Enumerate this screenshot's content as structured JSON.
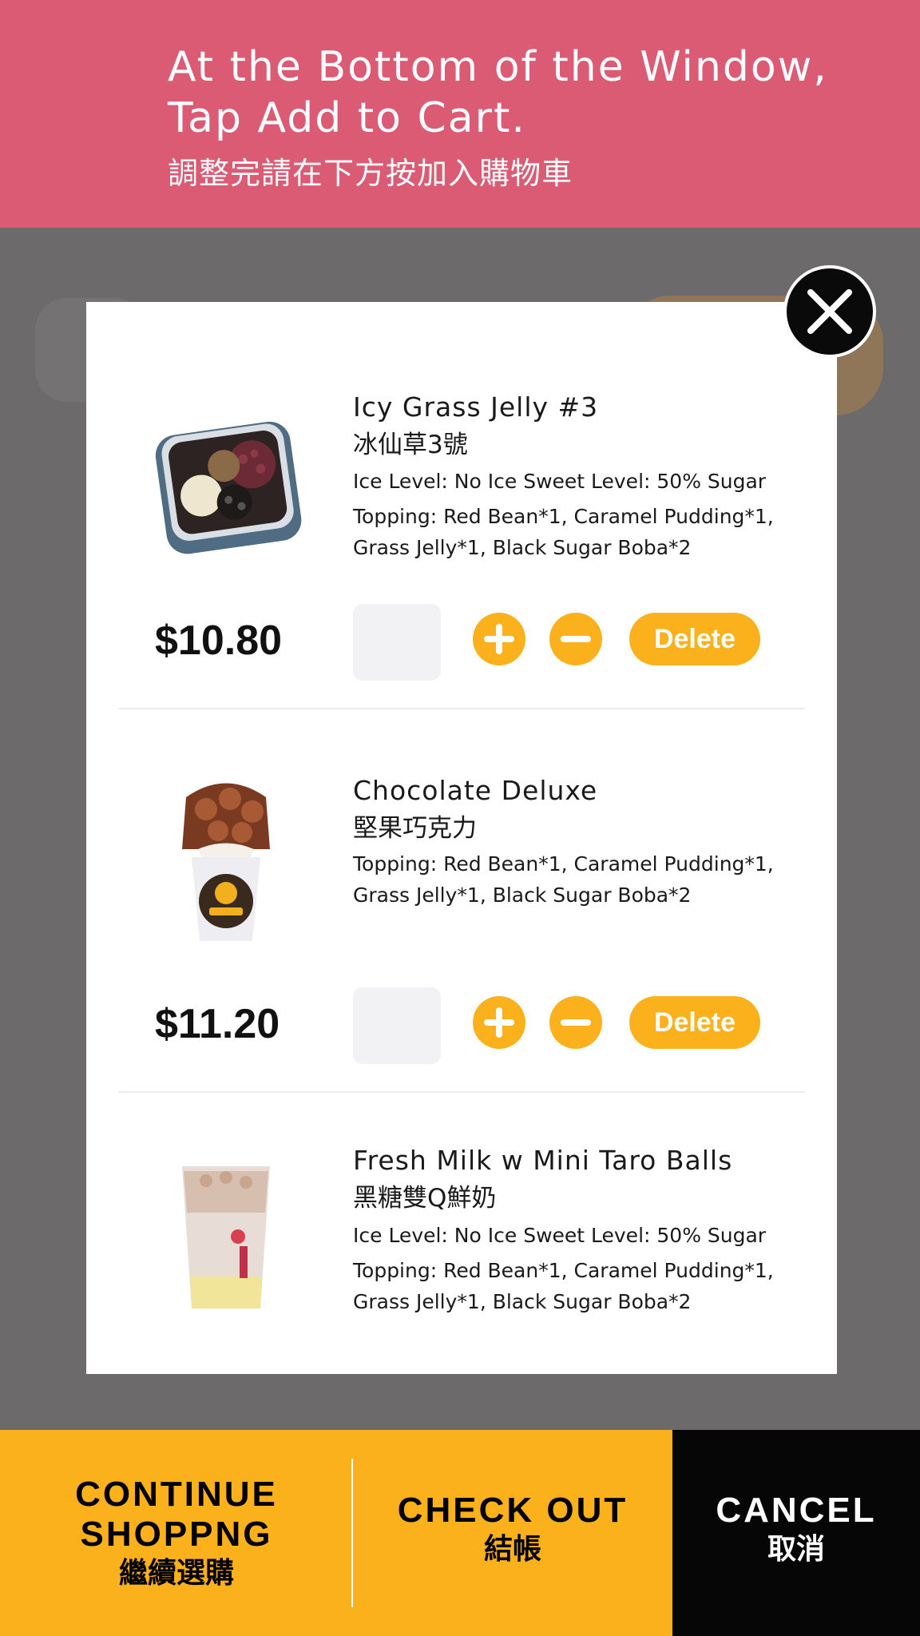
{
  "banner": {
    "line1": "At the Bottom of the Window,",
    "line2": "Tap Add to Cart.",
    "zh": "調整完請在下方按加入購物車"
  },
  "cart": {
    "items": [
      {
        "name": "Icy Grass Jelly #3",
        "name_zh": "冰仙草3號",
        "options": "Ice Level: No Ice  Sweet Level: 50% Sugar",
        "topping_line1": "Topping: Red Bean*1, Caramel Pudding*1,",
        "topping_line2": "Grass Jelly*1, Black Sugar Boba*2",
        "price": "$10.80",
        "delete_label": "Delete"
      },
      {
        "name": "Chocolate Deluxe",
        "name_zh": "堅果巧克力",
        "topping_line1": "Topping: Red Bean*1, Caramel Pudding*1,",
        "topping_line2": "Grass Jelly*1, Black Sugar Boba*2",
        "price": "$11.20",
        "delete_label": "Delete"
      },
      {
        "name": "Fresh Milk w Mini Taro Balls",
        "name_zh": "黑糖雙Q鮮奶",
        "options": "Ice Level: No Ice  Sweet Level: 50% Sugar",
        "topping_line1": "Topping: Red Bean*1, Caramel Pudding*1,",
        "topping_line2": "Grass Jelly*1, Black Sugar Boba*2"
      }
    ]
  },
  "bottom_bar": {
    "continue_line1": "CONTINUE",
    "continue_line2": "SHOPPNG",
    "continue_zh": "繼續選購",
    "checkout_en": "CHECK OUT",
    "checkout_zh": "結帳",
    "cancel_en": "CANCEL",
    "cancel_zh": "取消"
  },
  "colors": {
    "banner": "#dc5b74",
    "accent": "#fbb11b",
    "cancel": "#060606",
    "overlay": "#6d6a6b"
  },
  "icons": [
    "close-icon",
    "plus-icon",
    "minus-icon"
  ]
}
